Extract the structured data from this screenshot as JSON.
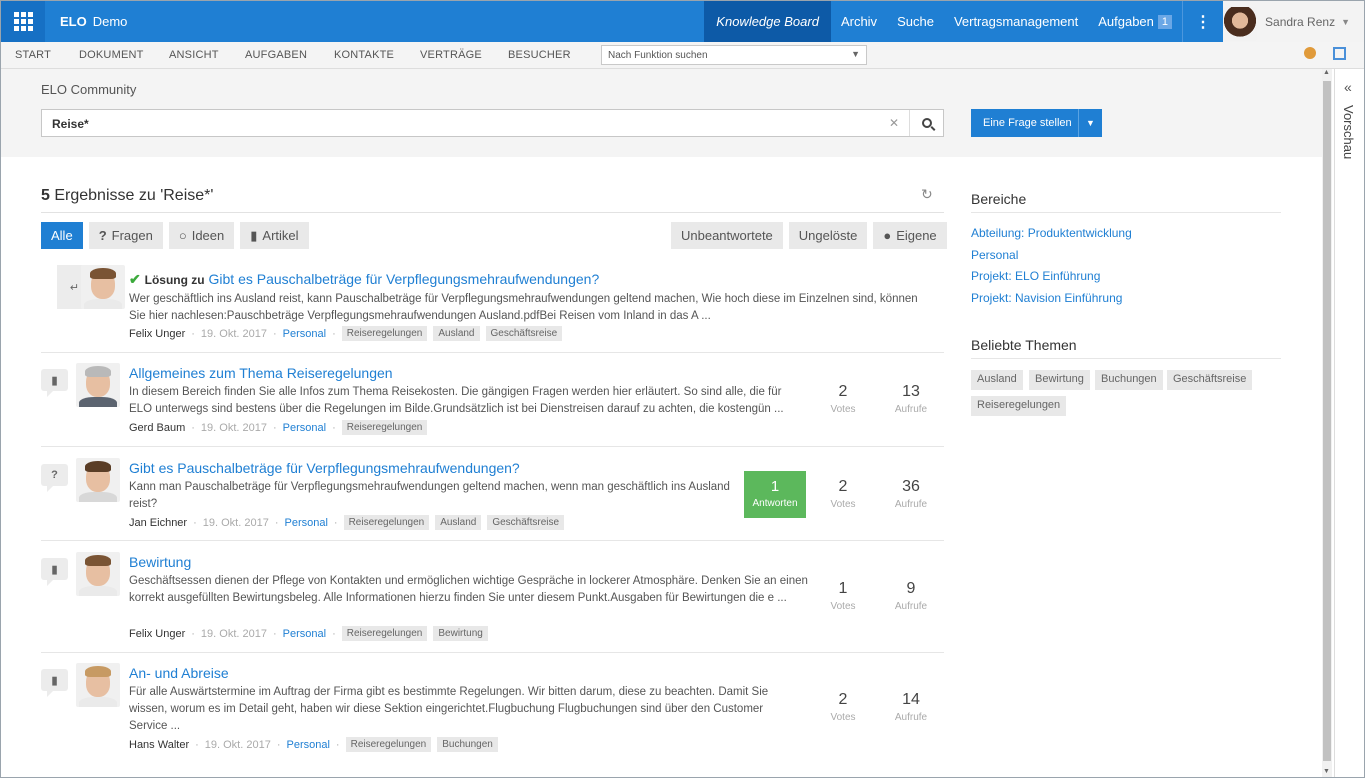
{
  "topbar": {
    "brand": "ELO",
    "brand_sub": "Demo",
    "nav": [
      "Knowledge Board",
      "Archiv",
      "Suche",
      "Vertragsmanagement"
    ],
    "tasks_label": "Aufgaben",
    "tasks_count": "1",
    "user_name": "Sandra Renz"
  },
  "menubar": {
    "items": [
      "START",
      "DOKUMENT",
      "ANSICHT",
      "AUFGABEN",
      "KONTAKTE",
      "VERTRÄGE",
      "BESUCHER"
    ],
    "function_search_placeholder": "Nach Funktion suchen"
  },
  "preview_label": "Vorschau",
  "search": {
    "section_title": "ELO Community",
    "query": "Reise*",
    "ask_button": "Eine Frage stellen"
  },
  "results": {
    "count": "5",
    "heading_text": "Ergebnisse zu 'Reise*'",
    "type_tabs": [
      "Alle",
      "Fragen",
      "Ideen",
      "Artikel"
    ],
    "filter_tabs": [
      "Unbeantwortete",
      "Ungelöste",
      "Eigene"
    ],
    "items": [
      {
        "kind": "answer",
        "solution_label": "Lösung zu",
        "title": "Gibt es Pauschalbeträge für Verpflegungsmehraufwendungen?",
        "excerpt": "Wer geschäftlich ins Ausland reist, kann Pauschalbeträge für Verpflegungsmehraufwendungen geltend machen, Wie hoch diese im Einzelnen sind, können Sie hier nachlesen:Pauschbeträge Verpflegungsmehraufwendungen Ausland.pdfBei Reisen vom Inland in das A ...",
        "author": "Felix Unger",
        "date": "19. Okt. 2017",
        "area": "Personal",
        "tags": [
          "Reiseregelungen",
          "Ausland",
          "Geschäftsreise"
        ]
      },
      {
        "kind": "article",
        "title": "Allgemeines zum Thema Reiseregelungen",
        "excerpt": "In diesem Bereich finden Sie alle Infos zum Thema Reisekosten. Die gängigen Fragen werden hier erläutert. So sind alle, die für ELO unterwegs sind bestens über die Regelungen im Bilde.Grundsätzlich ist bei Dienstreisen darauf zu achten, die kostengün ...",
        "author": "Gerd Baum",
        "date": "19. Okt. 2017",
        "area": "Personal",
        "tags": [
          "Reiseregelungen"
        ],
        "votes": "2",
        "views": "13"
      },
      {
        "kind": "question",
        "title": "Gibt es Pauschalbeträge für Verpflegungsmehraufwendungen?",
        "excerpt": "Kann man Pauschalbeträge für Verpflegungsmehraufwendungen geltend machen, wenn man geschäftlich ins Ausland reist?",
        "author": "Jan Eichner",
        "date": "19. Okt. 2017",
        "area": "Personal",
        "tags": [
          "Reiseregelungen",
          "Ausland",
          "Geschäftsreise"
        ],
        "answers": "1",
        "votes": "2",
        "views": "36"
      },
      {
        "kind": "article",
        "title": "Bewirtung",
        "excerpt": "Geschäftsessen dienen der Pflege von Kontakten und ermöglichen wichtige Gespräche in lockerer Atmosphäre. Denken Sie an einen korrekt ausgefüllten Bewirtungsbeleg. Alle Informationen hierzu finden Sie unter diesem Punkt.Ausgaben für Bewirtungen die e ...",
        "author": "Felix Unger",
        "date": "19. Okt. 2017",
        "area": "Personal",
        "tags": [
          "Reiseregelungen",
          "Bewirtung"
        ],
        "votes": "1",
        "views": "9"
      },
      {
        "kind": "article",
        "title": "An- und Abreise",
        "excerpt": "Für alle Auswärtstermine im Auftrag der Firma gibt es bestimmte Regelungen. Wir bitten darum, diese zu beachten. Damit Sie wissen, worum es im Detail geht, haben wir diese Sektion eingerichtet.Flugbuchung Flugbuchungen sind über den Customer Service ...",
        "author": "Hans Walter",
        "date": "19. Okt. 2017",
        "area": "Personal",
        "tags": [
          "Reiseregelungen",
          "Buchungen"
        ],
        "votes": "2",
        "views": "14"
      }
    ],
    "labels": {
      "answers": "Antworten",
      "votes": "Votes",
      "views": "Aufrufe"
    }
  },
  "sidebar": {
    "areas_title": "Bereiche",
    "areas": [
      "Abteilung: Produktentwicklung",
      "Personal",
      "Projekt: ELO Einführung",
      "Projekt: Navision Einführung"
    ],
    "topics_title": "Beliebte Themen",
    "topics": [
      "Ausland",
      "Bewirtung",
      "Buchungen",
      "Geschäftsreise",
      "Reiseregelungen"
    ]
  },
  "colors": {
    "primary": "#1f7fd3",
    "active_nav": "#0d5aa7",
    "success": "#5cb85c"
  }
}
